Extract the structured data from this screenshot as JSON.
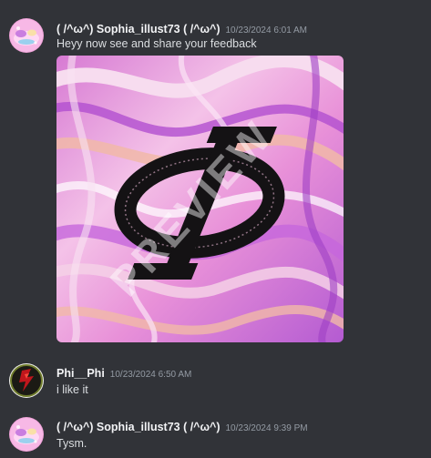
{
  "messages": [
    {
      "username": "( /^ω^) Sophia_illust73 ( /^ω^)",
      "timestamp": "10/23/2024 6:01 AM",
      "text": "Heyy now see and share your feedback",
      "attachment": {
        "watermark": "PREVIEW"
      }
    },
    {
      "username": "Phi__Phi",
      "timestamp": "10/23/2024 6:50 AM",
      "text": "i like it"
    },
    {
      "username": "( /^ω^) Sophia_illust73 ( /^ω^)",
      "timestamp": "10/23/2024 9:39 PM",
      "text": "Tysm."
    }
  ],
  "colors": {
    "background": "#313338",
    "username": "#f2f3f5",
    "timestamp": "#949ba4",
    "message_text": "#dbdee1",
    "swirl_pink": "#e88fd6",
    "swirl_purple": "#b35ad6",
    "swirl_peach": "#f1b9a8",
    "logo": "#141214"
  },
  "icons": {
    "avatar_1": "pink-cloud-avatar-icon",
    "avatar_2": "red-dark-avatar-icon",
    "avatar_3": "pink-cloud-avatar-icon"
  }
}
